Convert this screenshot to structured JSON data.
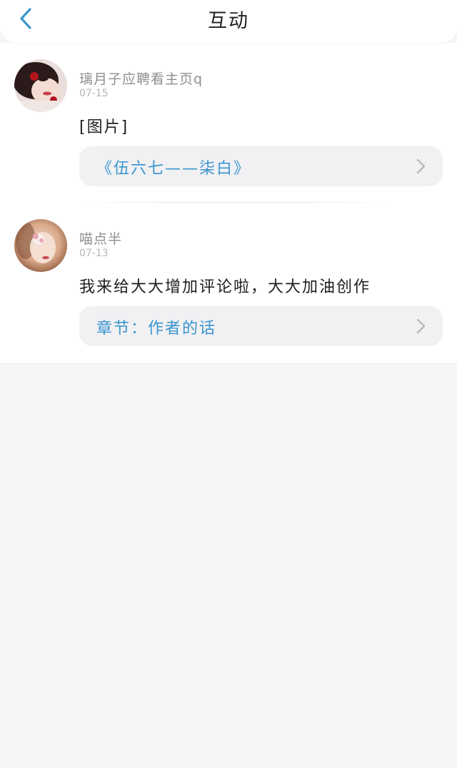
{
  "header": {
    "title": "互动",
    "back_icon": "chevron-left-icon",
    "accent_color": "#3a95cf"
  },
  "comments": [
    {
      "user_name": "璃月子应聘看主页q",
      "date": "07-15",
      "text": "[图片]",
      "link": {
        "label": "《伍六七——柒白》",
        "icon": "chevron-right-icon"
      }
    },
    {
      "user_name": "喵点半",
      "date": "07-13",
      "text": "我来给大大增加评论啦，大大加油创作",
      "link": {
        "label": "章节：作者的话",
        "icon": "chevron-right-icon"
      }
    }
  ]
}
